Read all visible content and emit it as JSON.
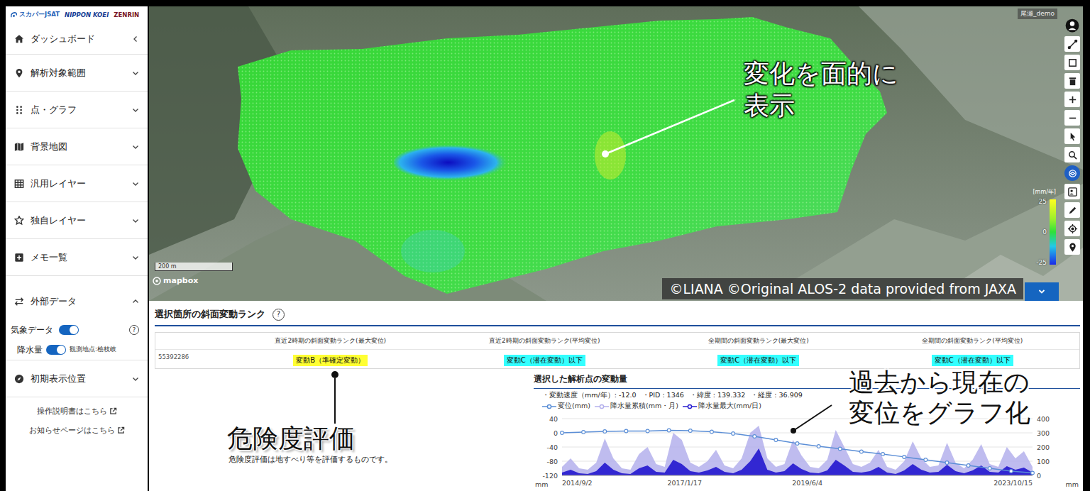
{
  "logos": [
    "スカパーJSAT",
    "NIPPON KOEI",
    "ZENRIN"
  ],
  "sidebar": {
    "items": [
      {
        "label": "ダッシュボード",
        "kind": "home",
        "expanded": false
      },
      {
        "label": "解析対象範囲",
        "kind": "pin",
        "expanded": false
      },
      {
        "label": "点・グラフ",
        "kind": "dots",
        "expanded": false
      },
      {
        "label": "背景地図",
        "kind": "map",
        "expanded": false
      },
      {
        "label": "汎用レイヤー",
        "kind": "table",
        "expanded": false
      },
      {
        "label": "独自レイヤー",
        "kind": "badge",
        "expanded": false
      },
      {
        "label": "メモ一覧",
        "kind": "memo",
        "expanded": false
      },
      {
        "label": "外部データ",
        "kind": "exchange",
        "expanded": true,
        "toggles": [
          {
            "label": "気象データ",
            "on": true,
            "help": "?"
          },
          {
            "label": "降水量",
            "on": true,
            "note": "観測地点:桧枝岐"
          }
        ]
      },
      {
        "label": "初期表示位置",
        "kind": "compass",
        "expanded": false
      }
    ],
    "links": [
      "操作説明書はこちら",
      "お知らせページはこちら"
    ]
  },
  "map": {
    "user": "尾瀬_demo",
    "scale": "200 m",
    "attribution": "mapbox",
    "copyright": "©LIANA ©Original ALOS-2 data provided from JAXA",
    "legend": {
      "unit": "[mm/年]",
      "ticks": [
        "25",
        "0",
        "-25"
      ]
    },
    "callout": [
      "変化を面的に",
      "表示"
    ],
    "toolbar": [
      {
        "kind": "account",
        "selected": false
      },
      {
        "kind": "line",
        "selected": false
      },
      {
        "kind": "rect",
        "selected": false
      },
      {
        "kind": "trash",
        "selected": false
      },
      {
        "kind": "zoom-in",
        "selected": false
      },
      {
        "kind": "zoom-out",
        "selected": false
      },
      {
        "kind": "select",
        "selected": false
      },
      {
        "kind": "search",
        "selected": false
      },
      {
        "kind": "layers",
        "selected": true
      },
      {
        "kind": "panel",
        "selected": false
      },
      {
        "kind": "brush",
        "selected": false
      },
      {
        "kind": "locate",
        "selected": false
      },
      {
        "kind": "pin",
        "selected": false
      }
    ]
  },
  "ranks": {
    "title": "選択箇所の斜面変動ランク",
    "help": "?",
    "columns": [
      "直近2時期の斜面変動ランク(最大変位)",
      "直近2時期の斜面変動ランク(平均変位)",
      "全期間の斜面変動ランク(最大変位)",
      "全期間の斜面変動ランク(平均変位)"
    ],
    "rows": [
      {
        "id": "55392286",
        "cells": [
          {
            "text": "変動B（準確定変動）",
            "color": "#ffff33"
          },
          {
            "text": "変動C（潜在変動）以下",
            "color": "#33ffff"
          },
          {
            "text": "変動C（潜在変動）以下",
            "color": "#33ffff"
          },
          {
            "text": "変動C（潜在変動）以下",
            "color": "#33ffff"
          }
        ]
      }
    ]
  },
  "risk": {
    "title": "危険度評価",
    "note": "危険度評価は地すべり等を評価するものです。"
  },
  "chart": {
    "title": "選択した解析点の変動量",
    "info": [
      "・変動速度（mm/年）: -12.0",
      "・PID : 1346",
      "・緯度 : 139.332",
      "・経度 : 36.909"
    ],
    "series": [
      {
        "label": "変位(mm)",
        "kind": "line",
        "color": "#5b8ed6",
        "values": [
          0,
          2,
          4,
          5,
          5,
          7,
          6,
          3,
          -2,
          -10,
          -20,
          -30,
          -38,
          -45,
          -53,
          -60,
          -68,
          -76,
          -84,
          -92,
          -100,
          -108,
          -113
        ]
      },
      {
        "label": "降水量累積(mm・月)",
        "kind": "area",
        "color": "#b4b0ec",
        "values": [
          60,
          120,
          50,
          40,
          90,
          260,
          120,
          50,
          40,
          150,
          200,
          80,
          60,
          300,
          250,
          90,
          60,
          100,
          180,
          70,
          50,
          120,
          300,
          350,
          120,
          60,
          80,
          250,
          140,
          60,
          50,
          110,
          320,
          200,
          80,
          60,
          90,
          180,
          60,
          40,
          100,
          240,
          120,
          60,
          70,
          230,
          90,
          50,
          110,
          220,
          80,
          60,
          200,
          120,
          170,
          60
        ]
      },
      {
        "label": "降水量最大(mm/日)",
        "kind": "area",
        "color": "#2a1fd0",
        "values": [
          20,
          40,
          15,
          10,
          30,
          90,
          40,
          15,
          10,
          50,
          70,
          25,
          20,
          110,
          80,
          30,
          20,
          35,
          60,
          25,
          15,
          40,
          100,
          190,
          40,
          20,
          30,
          85,
          45,
          20,
          15,
          35,
          110,
          70,
          25,
          20,
          30,
          60,
          20,
          10,
          35,
          80,
          40,
          20,
          25,
          75,
          30,
          15,
          35,
          70,
          25,
          20,
          65,
          40,
          55,
          20
        ]
      }
    ],
    "left_ticks": [
      "40",
      "0",
      "-40",
      "-80",
      "-120"
    ],
    "right_ticks": [
      "400",
      "300",
      "200",
      "100",
      "0"
    ],
    "unit_left": "mm",
    "unit_right": "mm",
    "dates": [
      "2014/9/2",
      "2017/1/17",
      "2019/6/4",
      "2023/10/15"
    ],
    "callout": [
      "過去から現在の",
      "変位をグラフ化"
    ]
  }
}
